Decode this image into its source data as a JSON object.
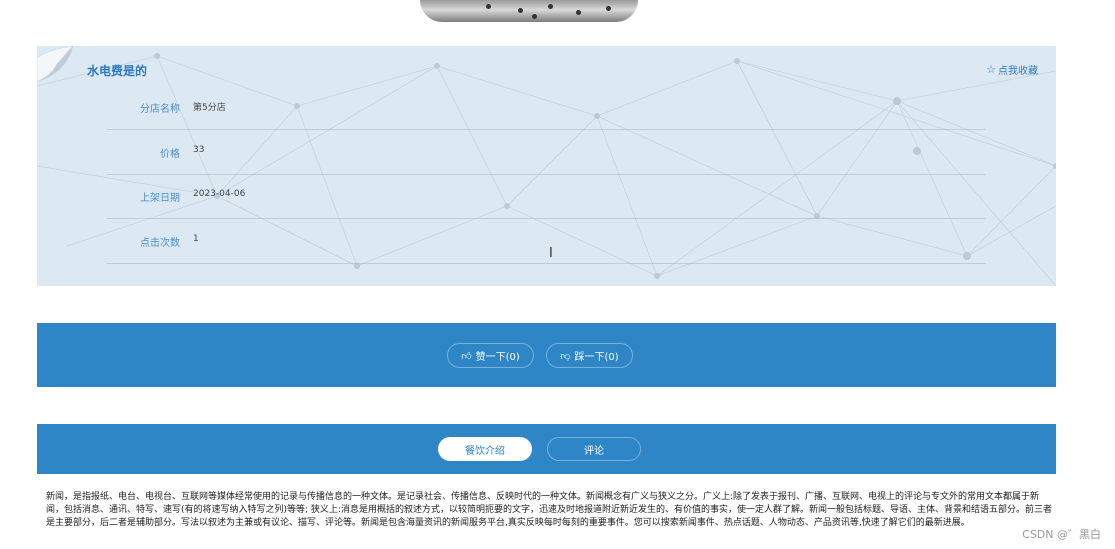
{
  "detail": {
    "title": "水电费是的",
    "collect_label": "点我收藏",
    "fields": [
      {
        "label": "分店名称",
        "value": "第5分店"
      },
      {
        "label": "价格",
        "value": "33"
      },
      {
        "label": "上架日期",
        "value": "2023-04-06"
      },
      {
        "label": "点击次数",
        "value": "1"
      }
    ]
  },
  "vote": {
    "like_label": "赞一下(0)",
    "dislike_label": "踩一下(0)"
  },
  "tabs": [
    {
      "label": "餐饮介绍",
      "active": true
    },
    {
      "label": "评论",
      "active": false
    }
  ],
  "content": {
    "text": "新闻，是指报纸、电台、电视台、互联网等媒体经常使用的记录与传播信息的一种文体。是记录社会、传播信息、反映时代的一种文体。新闻概念有广义与狭义之分。广义上:除了发表于报刊、广播、互联网、电视上的评论与专文外的常用文本都属于新闻，包括消息、通讯、特写、速写(有的将速写纳入特写之列)等等; 狭义上:消息是用概括的叙述方式，以较简明扼要的文字，迅速及时地报道附近新近发生的、有价值的事实，使一定人群了解。新闻一般包括标题、导语、主体、背景和结语五部分。前三者是主要部分，后二者是辅助部分。写法以叙述为主兼或有议论、描写、评论等。新闻是包含海量资讯的新闻服务平台,真实反映每时每刻的重要事件。您可以搜索新闻事件、热点话题、人物动态、产品资讯等,快速了解它们的最新进展。"
  },
  "watermark": "CSDN @゛黑白",
  "colors": {
    "accent": "#2e86c6",
    "panel_bg": "#dde9f2",
    "label_blue": "#4a8cc6"
  },
  "icons": {
    "like": "thumbs-up-icon",
    "dislike": "thumbs-down-icon",
    "collect": "star-icon"
  }
}
